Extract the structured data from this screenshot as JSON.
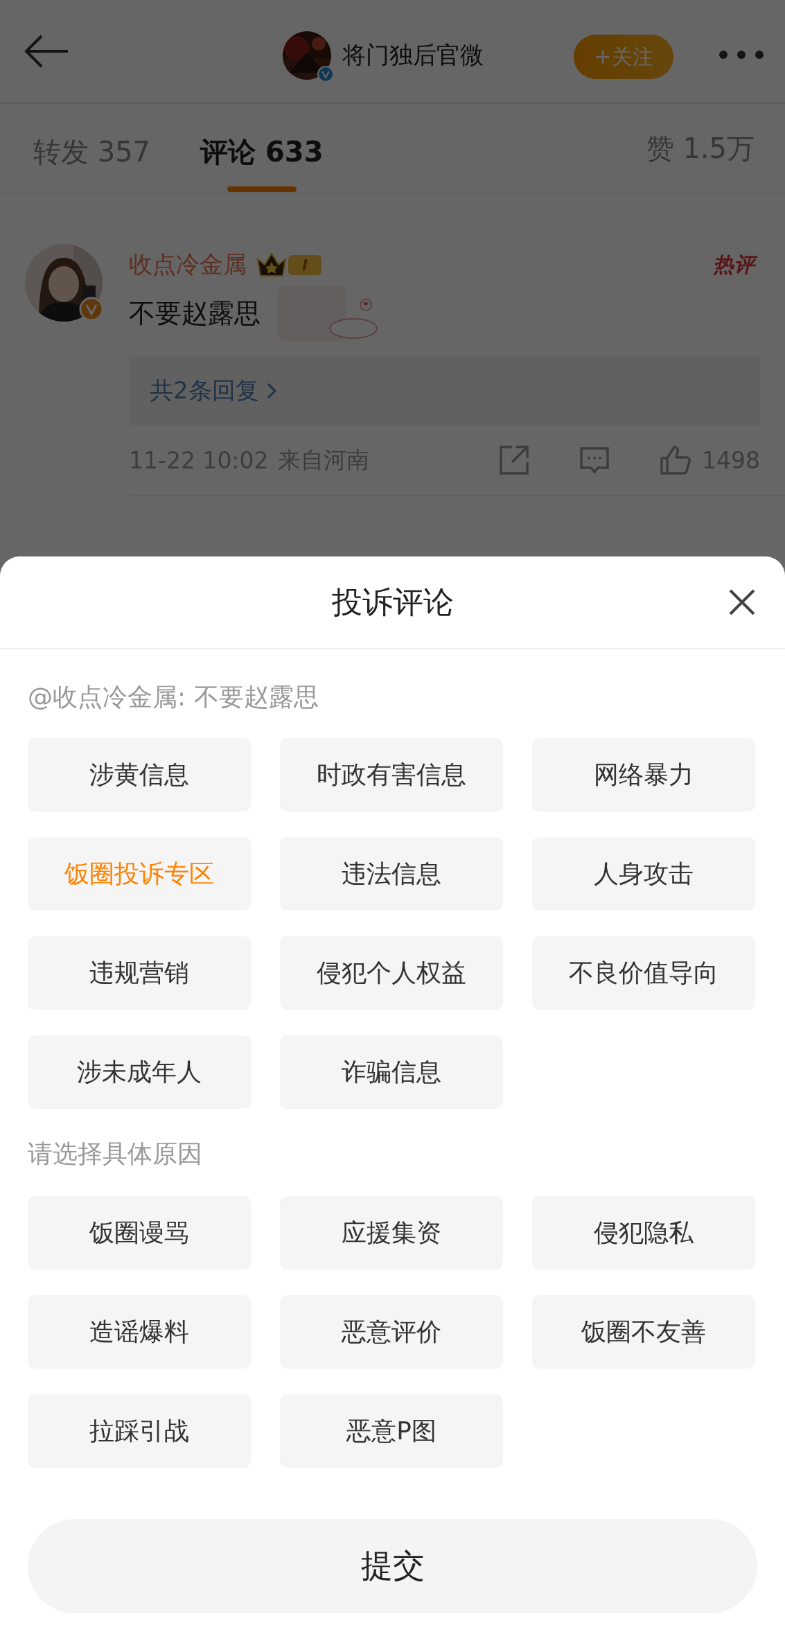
{
  "header": {
    "account_name": "将门独后官微",
    "verified": true,
    "follow_button": "+关注"
  },
  "tabs": [
    {
      "label": "转发 357",
      "selected": false
    },
    {
      "label": "评论 633",
      "selected": true
    }
  ],
  "likes_tab": "赞 1.5万",
  "comments": [
    {
      "user": "收点冷金属",
      "level_badge": "I",
      "hot_label": "热评",
      "verified": true,
      "text": "不要赵露思",
      "replies": "共2条回复",
      "time": "11-22 10:02",
      "location": "来自河南",
      "like_count": "1498"
    }
  ],
  "report_sheet": {
    "title": "投诉评论",
    "quote": "@收点冷金属: 不要赵露思",
    "categories": [
      {
        "label": "涉黄信息",
        "selected": false
      },
      {
        "label": "时政有害信息",
        "selected": false
      },
      {
        "label": "网络暴力",
        "selected": false
      },
      {
        "label": "饭圈投诉专区",
        "selected": true
      },
      {
        "label": "违法信息",
        "selected": false
      },
      {
        "label": "人身攻击",
        "selected": false
      },
      {
        "label": "违规营销",
        "selected": false
      },
      {
        "label": "侵犯个人权益",
        "selected": false
      },
      {
        "label": "不良价值导向",
        "selected": false
      },
      {
        "label": "涉未成年人",
        "selected": false
      },
      {
        "label": "诈骗信息",
        "selected": false
      }
    ],
    "reason_prompt": "请选择具体原因",
    "reasons": [
      {
        "label": "饭圈谩骂",
        "selected": false
      },
      {
        "label": "应援集资",
        "selected": false
      },
      {
        "label": "侵犯隐私",
        "selected": false
      },
      {
        "label": "造谣爆料",
        "selected": false
      },
      {
        "label": "恶意评价",
        "selected": false
      },
      {
        "label": "饭圈不友善",
        "selected": false
      },
      {
        "label": "拉踩引战",
        "selected": false
      },
      {
        "label": "恶意P图",
        "selected": false
      }
    ],
    "submit_button": "提交"
  }
}
